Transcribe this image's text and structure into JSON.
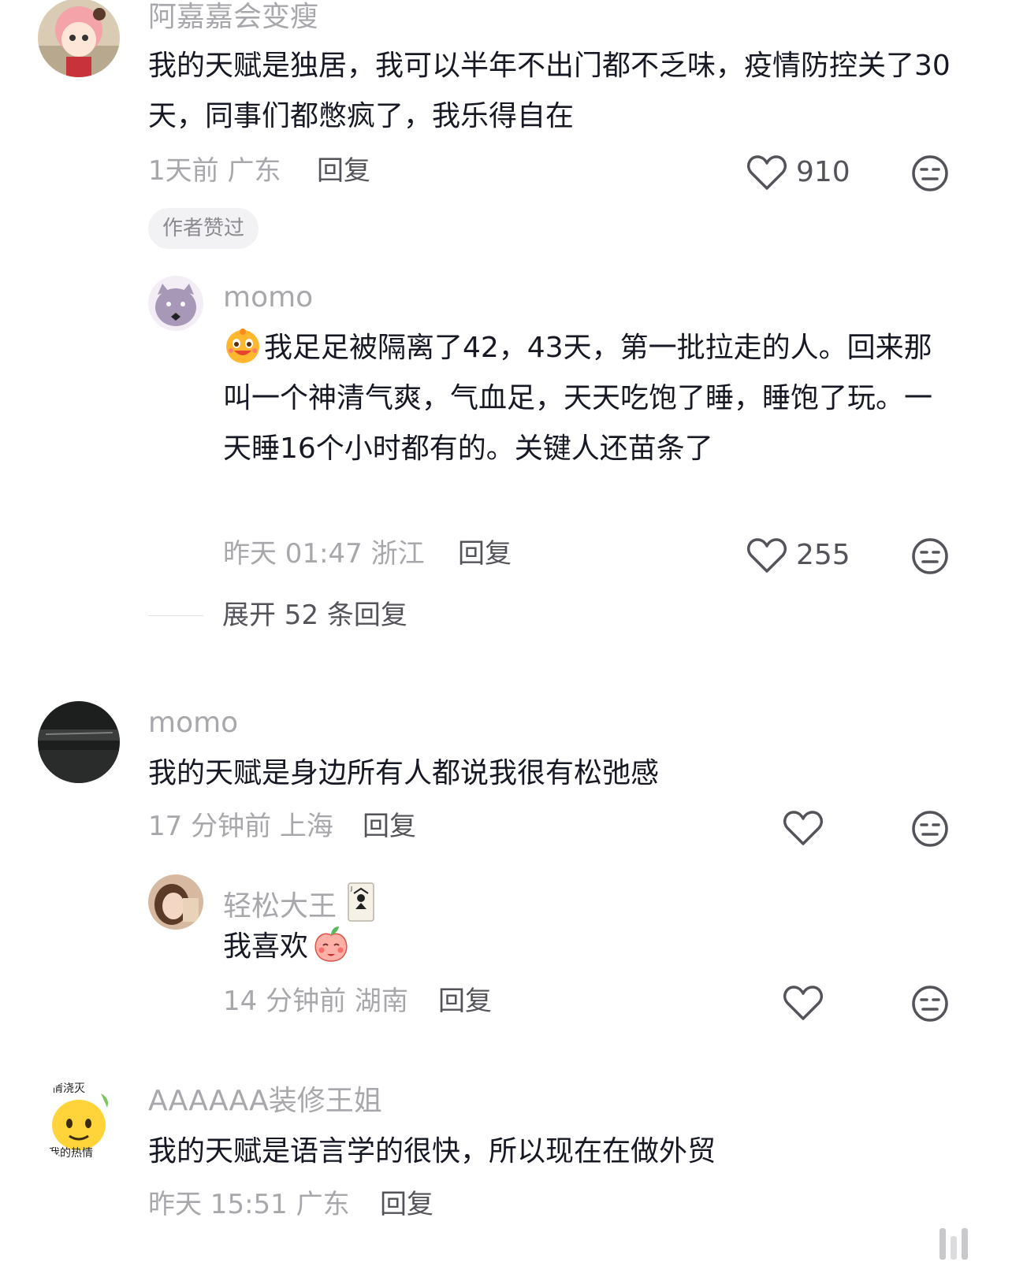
{
  "comments": [
    {
      "username": "阿嘉嘉会变瘦",
      "text": "我的天赋是独居，我可以半年不出门都不乏味，疫情防控关了30天，同事们都憋疯了，我乐得自在",
      "time": "1天前",
      "location": "广东",
      "reply_label": "回复",
      "likes": "910",
      "badge": "作者赞过",
      "replies": [
        {
          "username": "momo",
          "text": "我足足被隔离了42，43天，第一批拉走的人。回来那叫一个神清气爽，气血足，天天吃饱了睡，睡饱了玩。一天睡16个小时都有的。关键人还苗条了",
          "time": "昨天 01:47",
          "location": "浙江",
          "reply_label": "回复",
          "likes": "255"
        }
      ],
      "expand_label": "展开 52 条回复"
    },
    {
      "username": "momo",
      "text": "我的天赋是身边所有人都说我很有松弛感",
      "time": "17 分钟前",
      "location": "上海",
      "reply_label": "回复",
      "likes": "",
      "replies": [
        {
          "username": "轻松大王",
          "text": "我喜欢",
          "time": "14 分钟前",
          "location": "湖南",
          "reply_label": "回复",
          "likes": ""
        }
      ]
    },
    {
      "username": "AAAAAA装修王姐",
      "text": "我的天赋是语言学的很快，所以现在在做外贸",
      "time": "昨天 15:51",
      "location": "广东",
      "reply_label": "回复",
      "avatar_text_top": "情浇灭",
      "avatar_text_bottom": "我的热情"
    }
  ],
  "icons": {
    "like": "heart-outline-icon",
    "dislike": "meh-face-icon",
    "emoji_1": "grinning-face-emoji",
    "emoji_2": "blushing-peach-emoji",
    "badge_card": "joker-card-icon"
  }
}
